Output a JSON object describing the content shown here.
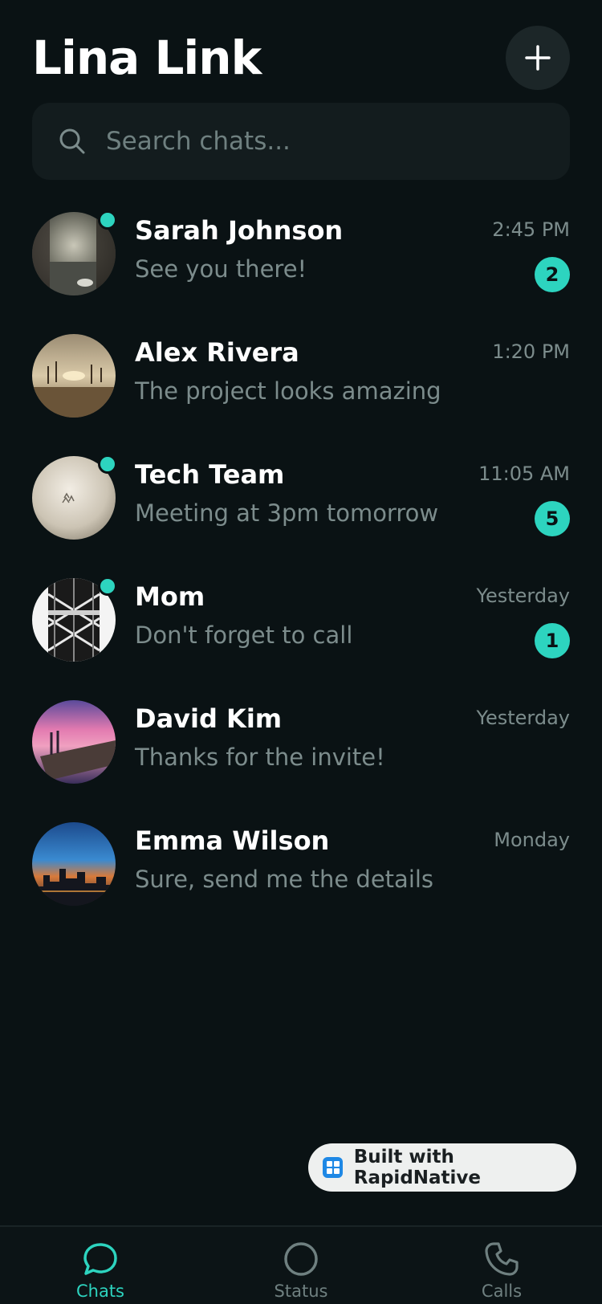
{
  "header": {
    "title": "Lina Link",
    "add_icon": "plus-icon"
  },
  "search": {
    "placeholder": "Search chats...",
    "value": "",
    "icon": "search-icon"
  },
  "colors": {
    "background": "#0a1214",
    "accent": "#2dd4bf",
    "muted": "#7c8c8c"
  },
  "chats": [
    {
      "name": "Sarah Johnson",
      "message": "See you there!",
      "time": "2:45 PM",
      "unread": "2",
      "online": true
    },
    {
      "name": "Alex Rivera",
      "message": "The project looks amazing",
      "time": "1:20 PM",
      "unread": "",
      "online": false
    },
    {
      "name": "Tech Team",
      "message": "Meeting at 3pm tomorrow",
      "time": "11:05 AM",
      "unread": "5",
      "online": true
    },
    {
      "name": "Mom",
      "message": "Don't forget to call",
      "time": "Yesterday",
      "unread": "1",
      "online": true
    },
    {
      "name": "David Kim",
      "message": "Thanks for the invite!",
      "time": "Yesterday",
      "unread": "",
      "online": false
    },
    {
      "name": "Emma Wilson",
      "message": "Sure, send me the details",
      "time": "Monday",
      "unread": "",
      "online": false
    }
  ],
  "badge": {
    "text": "Built with RapidNative"
  },
  "tabs": [
    {
      "label": "Chats",
      "icon": "chat-bubble-icon",
      "active": true
    },
    {
      "label": "Status",
      "icon": "status-circle-icon",
      "active": false
    },
    {
      "label": "Calls",
      "icon": "phone-icon",
      "active": false
    }
  ]
}
